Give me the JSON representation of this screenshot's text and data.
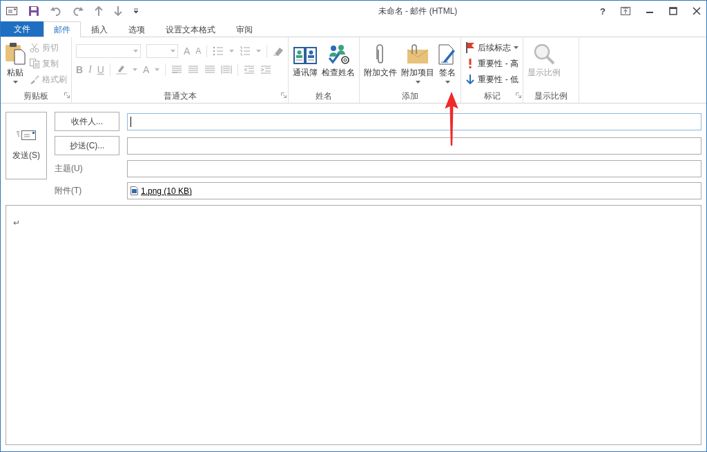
{
  "window": {
    "title": "未命名 - 邮件 (HTML)",
    "help": "?"
  },
  "tabs": [
    {
      "label": "文件",
      "kind": "file",
      "selected": false
    },
    {
      "label": "邮件",
      "kind": "tab",
      "selected": true
    },
    {
      "label": "插入",
      "kind": "tab",
      "selected": false
    },
    {
      "label": "选项",
      "kind": "tab",
      "selected": false
    },
    {
      "label": "设置文本格式",
      "kind": "tab",
      "selected": false
    },
    {
      "label": "审阅",
      "kind": "tab",
      "selected": false
    }
  ],
  "ribbon": {
    "groups": [
      {
        "label": "剪贴板",
        "launcher": true,
        "items": [
          {
            "kind": "large",
            "label": "粘贴",
            "dropdown": true,
            "disabled": false
          },
          {
            "kind": "small",
            "label": "剪切",
            "dropdown": false,
            "disabled": true
          },
          {
            "kind": "small",
            "label": "复制",
            "dropdown": false,
            "disabled": true
          },
          {
            "kind": "small",
            "label": "格式刷",
            "dropdown": false,
            "disabled": true
          }
        ]
      },
      {
        "label": "普通文本",
        "launcher": true,
        "font_panel": {
          "disabled": true,
          "grow": "A",
          "shrink": "A",
          "bold": "B",
          "italic": "I",
          "underline": "U",
          "font_color": "A"
        }
      },
      {
        "label": "姓名",
        "launcher": false,
        "items": [
          {
            "kind": "large",
            "label": "通讯簿",
            "dropdown": false,
            "disabled": false
          },
          {
            "kind": "large",
            "label": "检查姓名",
            "dropdown": false,
            "disabled": false
          }
        ]
      },
      {
        "label": "添加",
        "launcher": false,
        "items": [
          {
            "kind": "large",
            "label": "附加文件",
            "dropdown": false,
            "disabled": false
          },
          {
            "kind": "large",
            "label": "附加项目",
            "dropdown": true,
            "disabled": false
          },
          {
            "kind": "large",
            "label": "签名",
            "dropdown": true,
            "disabled": false
          }
        ]
      },
      {
        "label": "标记",
        "launcher": true,
        "items": [
          {
            "kind": "small",
            "label": "后续标志",
            "dropdown": true,
            "disabled": false
          },
          {
            "kind": "small",
            "label": "重要性 - 高",
            "dropdown": false,
            "disabled": false
          },
          {
            "kind": "small",
            "label": "重要性 - 低",
            "dropdown": false,
            "disabled": false
          }
        ]
      },
      {
        "label": "显示比例",
        "launcher": false,
        "items": [
          {
            "kind": "large",
            "label": "显示比例",
            "dropdown": false,
            "disabled": true
          }
        ]
      }
    ]
  },
  "compose": {
    "send": {
      "label": "发送(S)"
    },
    "fields": [
      {
        "kind": "button",
        "label": "收件人...",
        "focused": true
      },
      {
        "kind": "button",
        "label": "抄送(C)...",
        "focused": false
      },
      {
        "kind": "text",
        "label": "主题(U)",
        "focused": false
      },
      {
        "kind": "attachment",
        "label": "附件(T)",
        "focused": false,
        "files": [
          "1.png (10 KB)"
        ]
      }
    ],
    "body": {
      "mark": "↵"
    }
  }
}
